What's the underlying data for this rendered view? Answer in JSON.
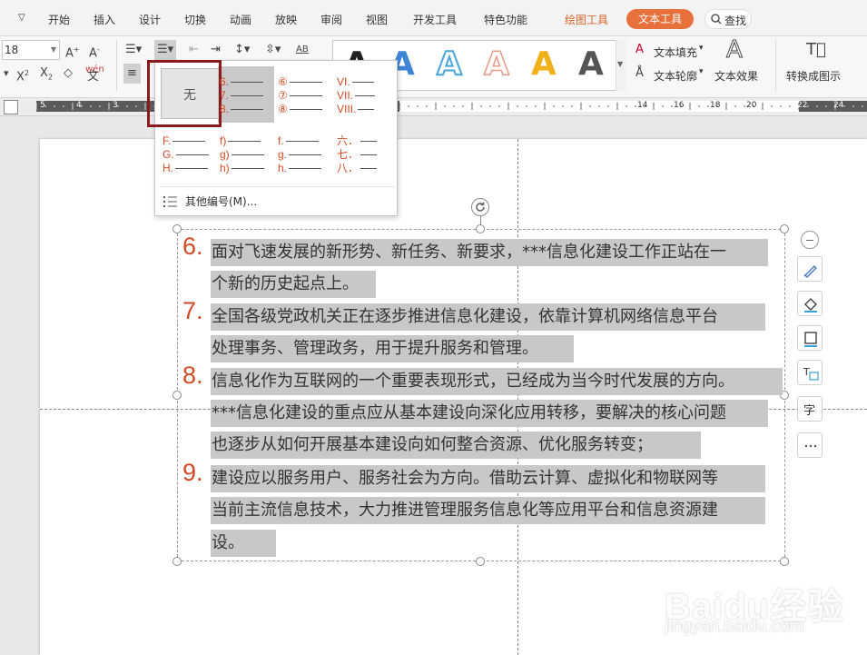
{
  "menu": {
    "items": [
      "开始",
      "插入",
      "设计",
      "切换",
      "动画",
      "放映",
      "审阅",
      "视图",
      "开发工具",
      "特色功能"
    ],
    "drawing_tools": "绘图工具",
    "text_tools": "文本工具",
    "search": "查找"
  },
  "ribbon": {
    "font_size": "18",
    "wordart_letter": "A",
    "text_fill": "文本填充",
    "text_outline": "文本轮廓",
    "text_effect": "文本效果",
    "convert_to_graphic": "转换成图示",
    "align_label": "AB"
  },
  "numbering_menu": {
    "none_label": "无",
    "col1a": [
      "6.",
      "7.",
      "8."
    ],
    "col2a": [
      "⑥",
      "⑦",
      "⑧"
    ],
    "col3a": [
      "VI.",
      "VII.",
      "VIII."
    ],
    "col0b": [
      "F.",
      "G.",
      "H."
    ],
    "col1b": [
      "f)",
      "g)",
      "h)"
    ],
    "col2b": [
      "f.",
      "g.",
      "h."
    ],
    "col3b": [
      "六．",
      "七．",
      "八．"
    ],
    "more": "其他编号(M)..."
  },
  "content": {
    "paragraphs": [
      {
        "num": "6.",
        "lines": [
          "面对飞速发展的新形势、新任务、新要求，***信息化建设工作正站在一",
          "个新的历史起点上。"
        ]
      },
      {
        "num": "7.",
        "lines": [
          "全国各级党政机关正在逐步推进信息化建设，依靠计算机网络信息平台",
          "处理事务、管理政务，用于提升服务和管理。"
        ]
      },
      {
        "num": "8.",
        "lines": [
          "信息化作为互联网的一个重要表现形式，已经成为当今时代发展的方向。",
          "***信息化建设的重点应从基本建设向深化应用转移，要解决的核心问题",
          "也逐步从如何开展基本建设向如何整合资源、优化服务转变；"
        ]
      },
      {
        "num": "9.",
        "lines": [
          "建设应以服务用户、服务社会为方向。借助云计算、虚拟化和物联网等",
          "当前主流信息技术，大力推进管理服务信息化等应用平台和信息资源建",
          "设。"
        ]
      }
    ]
  },
  "ruler_labels": [
    "5",
    "4",
    "3",
    "2",
    "1",
    "14",
    "16",
    "18",
    "20",
    "22",
    "24"
  ],
  "watermark": {
    "brand": "Baidu经验",
    "url": "jingyan.baidu.com"
  },
  "colors": {
    "accent": "#e8703a",
    "number": "#d14a24",
    "highlight_border": "#8b1a1a",
    "selection": "#c8c8c8"
  }
}
